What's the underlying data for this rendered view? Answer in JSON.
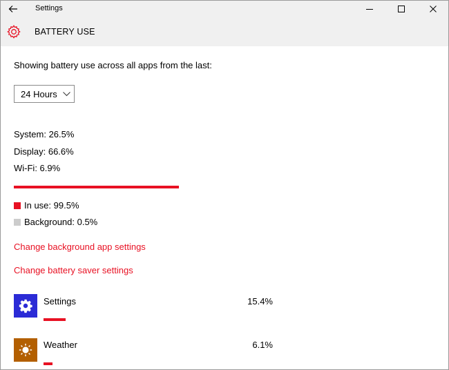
{
  "window": {
    "title": "Settings"
  },
  "header": {
    "title": "BATTERY USE",
    "icon": "gear-icon"
  },
  "intro": "Showing battery use across all apps from the last:",
  "timeframe": {
    "selected": "24 Hours"
  },
  "breakdown": [
    {
      "label": "System: 26.5%"
    },
    {
      "label": "Display: 66.6%"
    },
    {
      "label": "Wi-Fi: 6.9%"
    }
  ],
  "usage_bar": {
    "in_use_fraction": 0.995
  },
  "legend": [
    {
      "label": "In use: 99.5%",
      "color": "#e81123"
    },
    {
      "label": "Background: 0.5%",
      "color": "#cccccc"
    }
  ],
  "links": {
    "background_app": "Change background app settings",
    "battery_saver": "Change battery saver settings"
  },
  "apps": [
    {
      "name": "Settings",
      "percent": "15.4%",
      "icon": "gear-icon",
      "icon_bg": "#2b2bd6"
    },
    {
      "name": "Weather",
      "percent": "6.1%",
      "icon": "sun-icon",
      "icon_bg": "#b35f00"
    }
  ],
  "accent_color": "#e81123"
}
